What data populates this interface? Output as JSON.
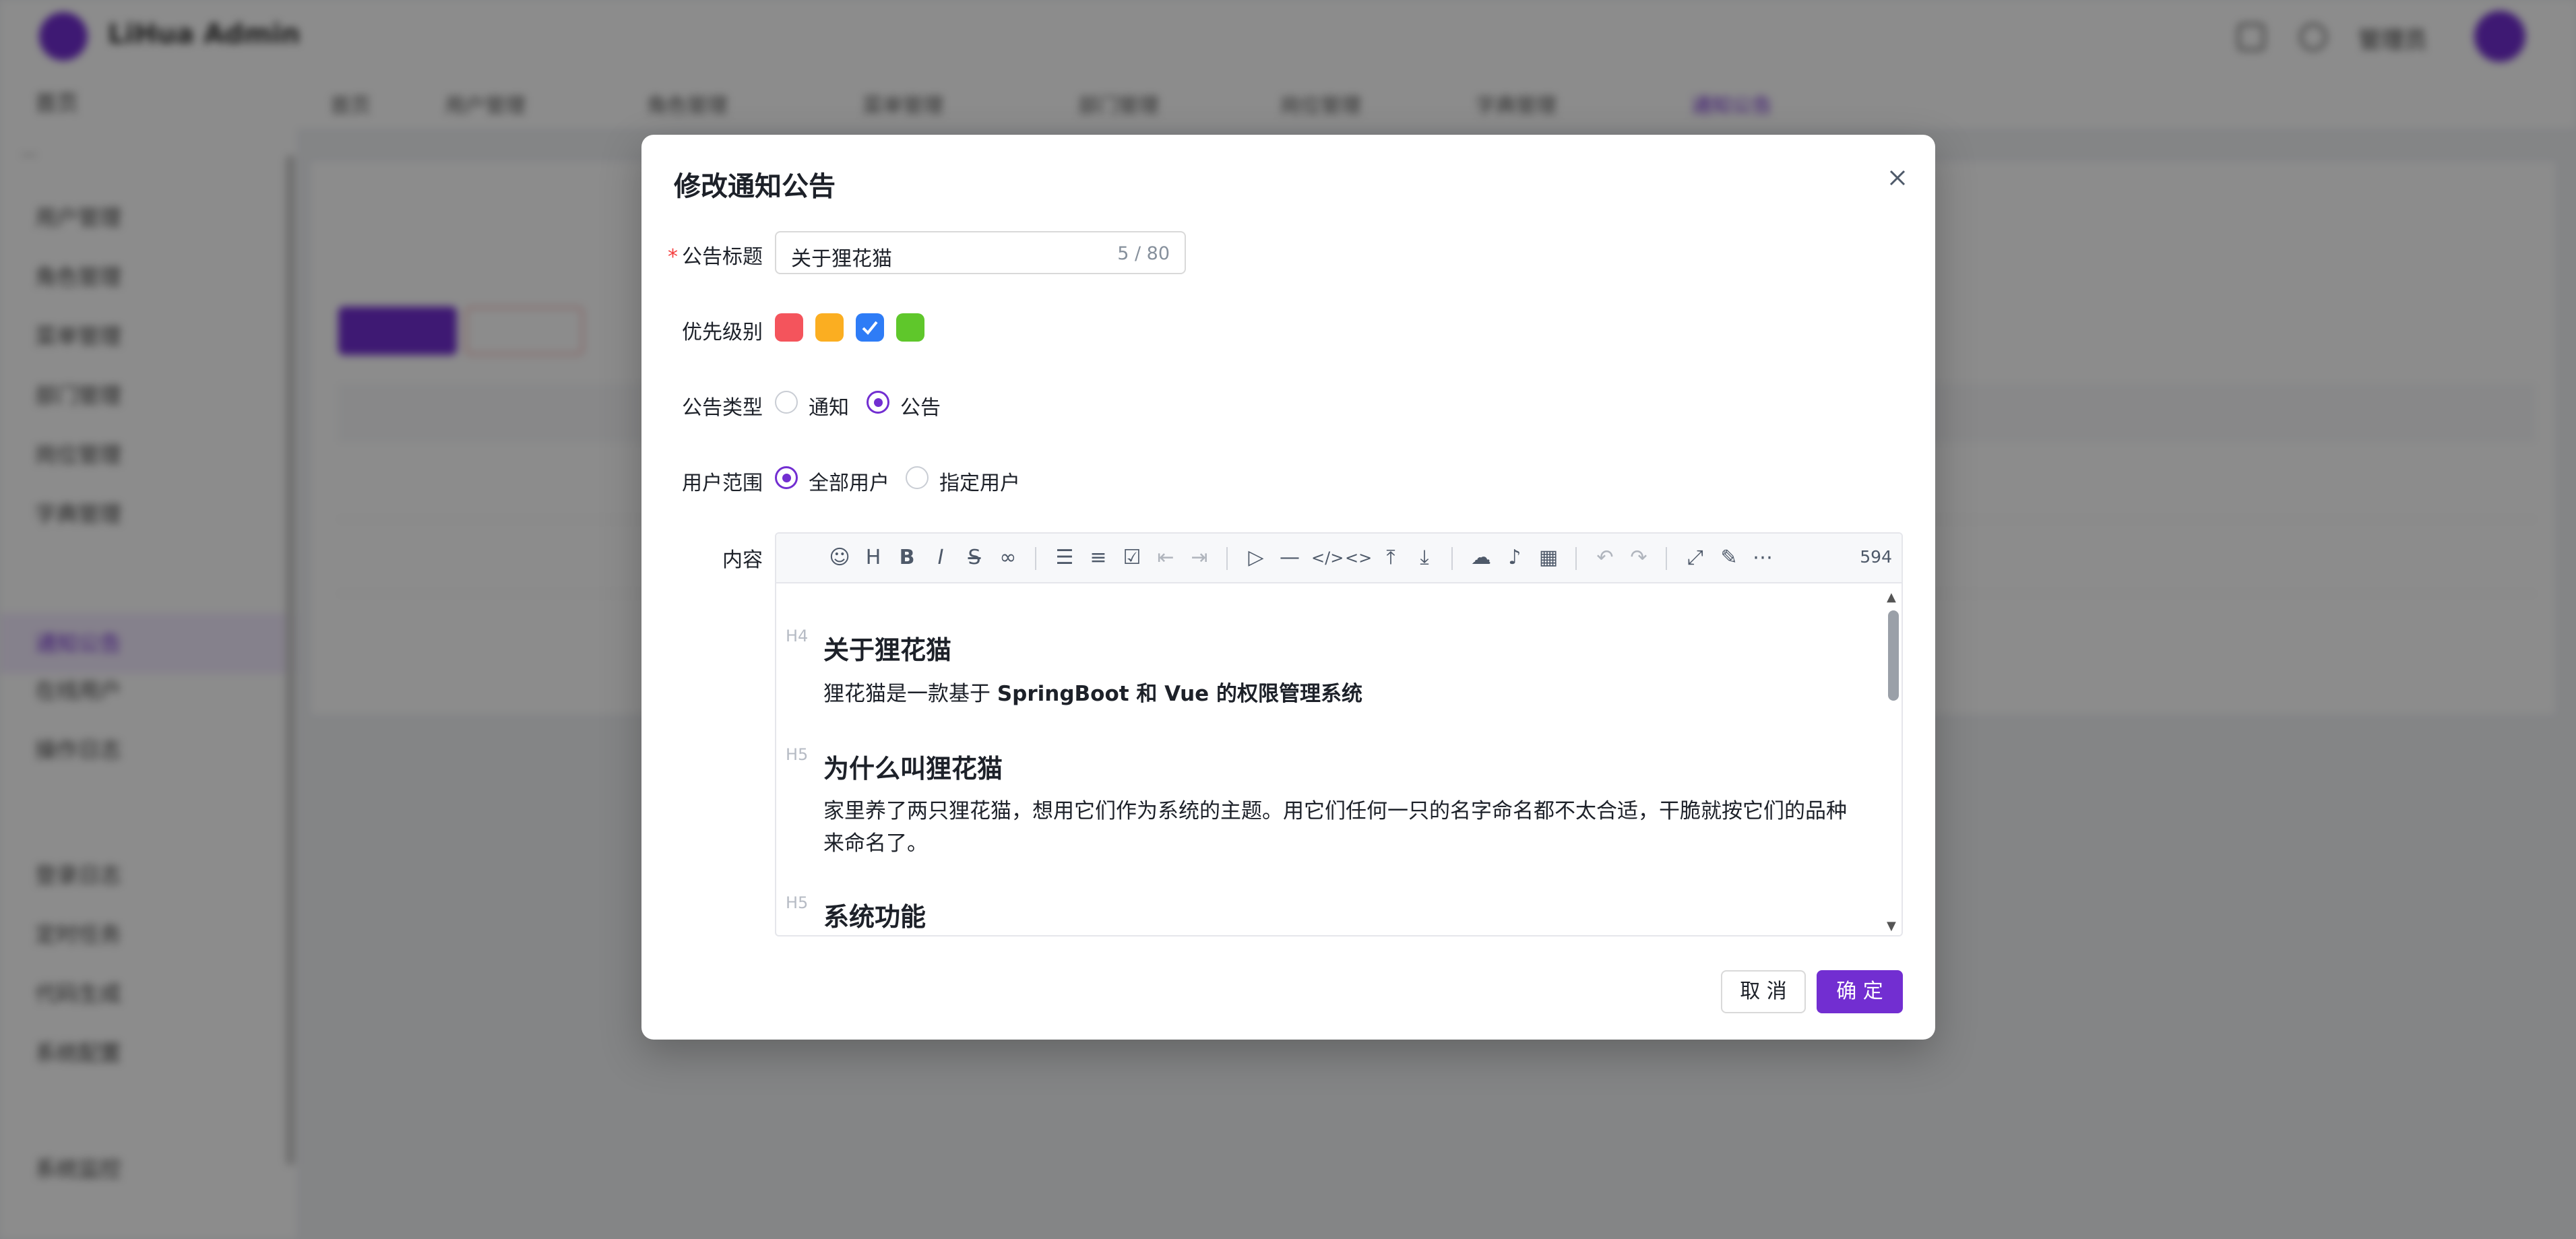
{
  "background": {
    "app_name": "LiHua Admin",
    "username": "管理员",
    "sidebar": {
      "items": [
        "首页",
        "用户管理",
        "角色管理",
        "菜单管理",
        "部门管理",
        "岗位管理",
        "字典管理",
        "通知公告",
        "在线用户",
        "操作日志",
        "登录日志",
        "定时任务",
        "代码生成",
        "系统配置",
        "系统监控"
      ],
      "active_item": "通知公告"
    },
    "tabs": [
      "首页",
      "用户管理",
      "角色管理",
      "菜单管理",
      "部门管理",
      "岗位管理",
      "字典管理",
      "通知公告"
    ]
  },
  "modal": {
    "title": "修改通知公告",
    "fields": {
      "title_label": "公告标题",
      "title_value": "关于狸花猫",
      "title_count": "5 / 80",
      "priority_label": "优先级别",
      "priority_colors": [
        "#f4545c",
        "#fbae21",
        "#2e7cf6",
        "#5fc72b"
      ],
      "priority_selected": "#2e7cf6",
      "type_label": "公告类型",
      "type_options": [
        "通知",
        "公告"
      ],
      "type_selected": "公告",
      "scope_label": "用户范围",
      "scope_options": [
        "全部用户",
        "指定用户"
      ],
      "scope_selected": "全部用户",
      "content_label": "内容"
    },
    "editor": {
      "word_count": "594",
      "toolbar_icons": [
        "emoji-icon",
        "heading-icon",
        "bold-icon",
        "italic-icon",
        "strikethrough-icon",
        "link-icon",
        "bullet-list-icon",
        "ordered-list-icon",
        "checklist-icon",
        "outdent-icon",
        "indent-icon",
        "quote-icon",
        "horizontal-rule-icon",
        "code-block-icon",
        "inline-code-icon",
        "sup-icon",
        "sub-icon",
        "upload-icon",
        "audio-icon",
        "table-icon",
        "undo-icon",
        "redo-icon",
        "fullscreen-icon",
        "edit-mode-icon",
        "more-icon"
      ],
      "doc": {
        "h1_marker": "H4",
        "h1": "关于狸花猫",
        "p1_prefix": "狸花猫是一款基于 ",
        "p1_bold": "SpringBoot 和 Vue 的权限管理系统",
        "h2_marker": "H5",
        "h2": "为什么叫狸花猫",
        "p2": "家里养了两只狸花猫，想用它们作为系统的主题。用它们任何一只的名字命名都不太合适，干脆就按它们的品种来命名了。",
        "h3_marker": "H5",
        "h3": "系统功能"
      }
    },
    "buttons": {
      "cancel": "取 消",
      "ok": "确 定"
    }
  }
}
